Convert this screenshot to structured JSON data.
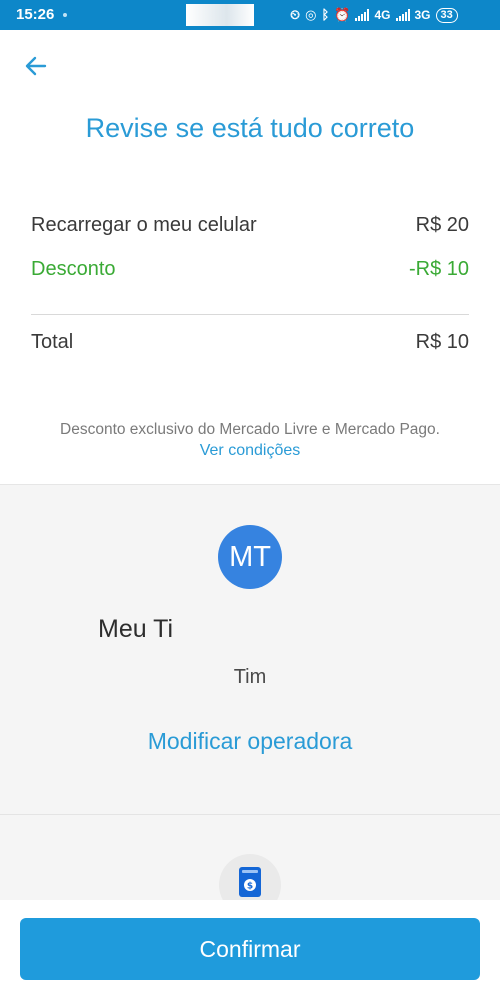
{
  "status_bar": {
    "time": "15:26",
    "network_1": "4G",
    "network_2": "3G",
    "battery": "33"
  },
  "header": {
    "title": "Revise se está tudo correto"
  },
  "summary": {
    "item_label": "Recarregar o meu celular",
    "item_value": "R$ 20",
    "discount_label": "Desconto",
    "discount_value": "-R$ 10",
    "total_label": "Total",
    "total_value": "R$ 10"
  },
  "note": {
    "text": "Desconto exclusivo do Mercado Livre e Mercado Pago.",
    "link": "Ver condições"
  },
  "contact": {
    "initials": "MT",
    "name": "Meu Ti",
    "operator": "Tim",
    "modify_link": "Modificar operadora"
  },
  "actions": {
    "confirm_label": "Confirmar"
  },
  "colors": {
    "accent": "#2a9bd6",
    "status_bar": "#0d87c9",
    "discount": "#3aaa35",
    "avatar": "#3683e0",
    "button": "#1f9bdc"
  },
  "icons": {
    "back": "arrow-left-icon",
    "payment": "money-card-icon"
  }
}
